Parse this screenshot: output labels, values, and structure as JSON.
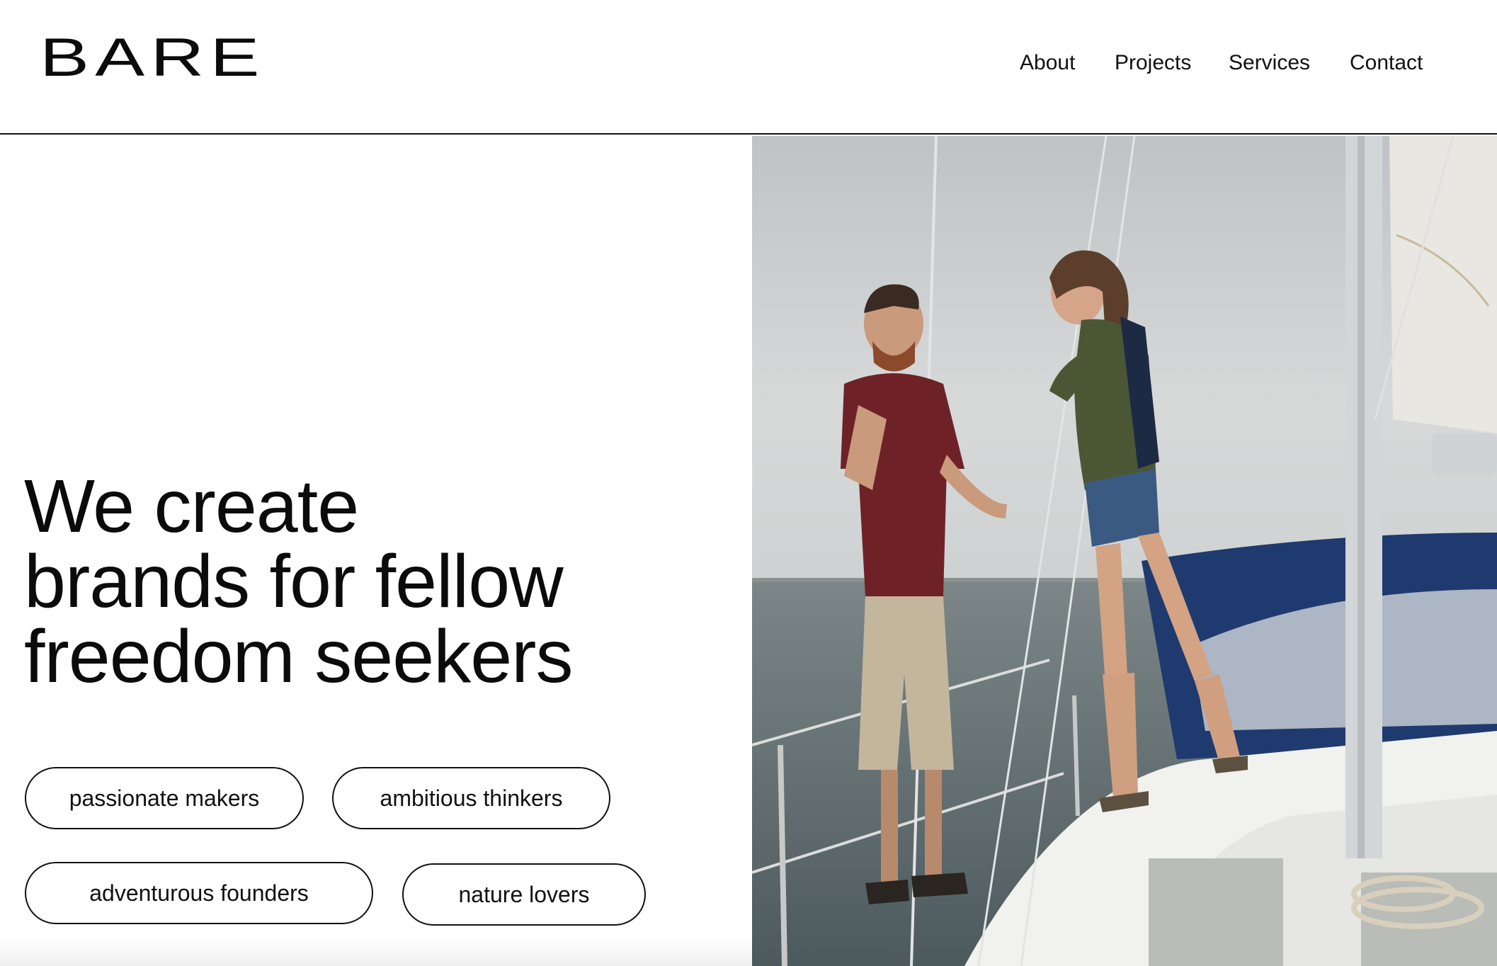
{
  "brand": {
    "logo_text": "BARE"
  },
  "nav": {
    "items": [
      {
        "label": "About"
      },
      {
        "label": "Projects"
      },
      {
        "label": "Services"
      },
      {
        "label": "Contact"
      }
    ]
  },
  "hero": {
    "headline_lines": [
      "We create",
      "brands for fellow",
      "freedom seekers"
    ],
    "tags": [
      {
        "label": "passionate makers"
      },
      {
        "label": "ambitious thinkers"
      },
      {
        "label": "adventurous founders"
      },
      {
        "label": "nature lovers"
      }
    ]
  },
  "image": {
    "subject": "couple-laughing-on-sailboat-photo"
  },
  "colors": {
    "text": "#0b0b0b",
    "background": "#ffffff",
    "border": "#111111",
    "sky": "#c9cccd",
    "sea": "#5d6a6d",
    "shirt": "#6e2228",
    "jacket": "#4b5734",
    "hull_blue": "#1f3a6e"
  }
}
